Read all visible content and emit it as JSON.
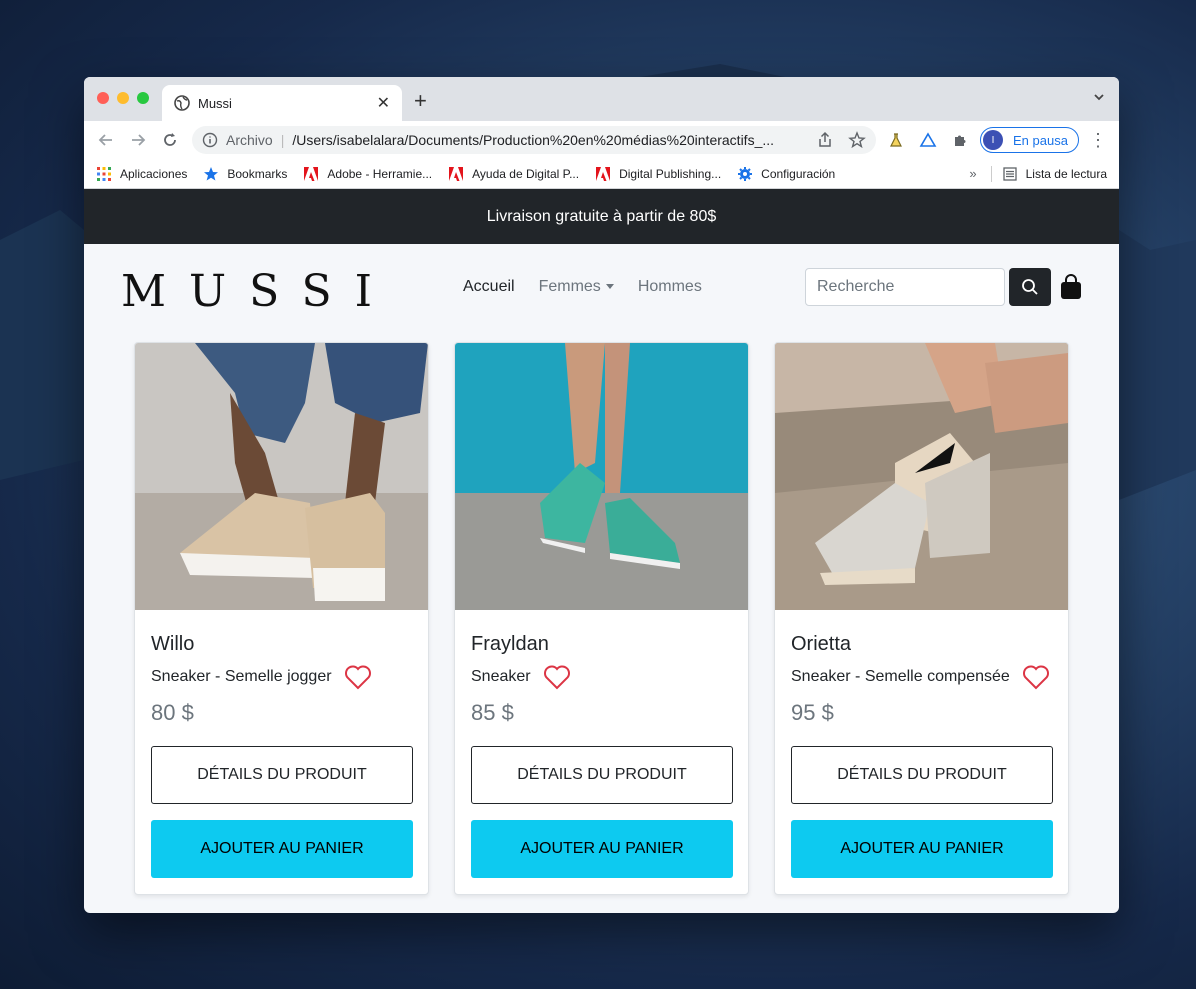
{
  "browser": {
    "tab_title": "Mussi",
    "omnibox_scheme": "Archivo",
    "omnibox_url": "/Users/isabelalara/Documents/Production%20en%20médias%20interactifs_...",
    "profile_initial": "I",
    "profile_label": "En pausa",
    "bookmarks": [
      {
        "label": "Aplicaciones",
        "icon": "apps-grid-icon"
      },
      {
        "label": "Bookmarks",
        "icon": "star-icon"
      },
      {
        "label": "Adobe - Herramie...",
        "icon": "adobe-icon"
      },
      {
        "label": "Ayuda de Digital P...",
        "icon": "adobe-icon"
      },
      {
        "label": "Digital Publishing...",
        "icon": "adobe-icon"
      },
      {
        "label": "Configuración",
        "icon": "gear-icon"
      }
    ],
    "bookmarks_overflow": "»",
    "reading_list": "Lista de lectura"
  },
  "banner": {
    "text": "Livraison gratuite à partir de 80$"
  },
  "site": {
    "logo": "MUSSI",
    "nav": {
      "home": "Accueil",
      "women": "Femmes",
      "men": "Hommes"
    },
    "search": {
      "placeholder": "Recherche"
    }
  },
  "products": [
    {
      "name": "Willo",
      "subtitle": "Sneaker - Semelle jogger",
      "price": "80 $",
      "details_label": "DÉTAILS DU PRODUIT",
      "cart_label": "AJOUTER AU PANIER"
    },
    {
      "name": "Frayldan",
      "subtitle": "Sneaker",
      "price": "85 $",
      "details_label": "DÉTAILS DU PRODUIT",
      "cart_label": "AJOUTER AU PANIER"
    },
    {
      "name": "Orietta",
      "subtitle": "Sneaker - Semelle compensée",
      "price": "95 $",
      "details_label": "DÉTAILS DU PRODUIT",
      "cart_label": "AJOUTER AU PANIER"
    }
  ],
  "colors": {
    "banner_bg": "#212529",
    "cart_button": "#0dcaf0",
    "heart": "#dc3545",
    "profile_accent": "#1a73e8"
  }
}
